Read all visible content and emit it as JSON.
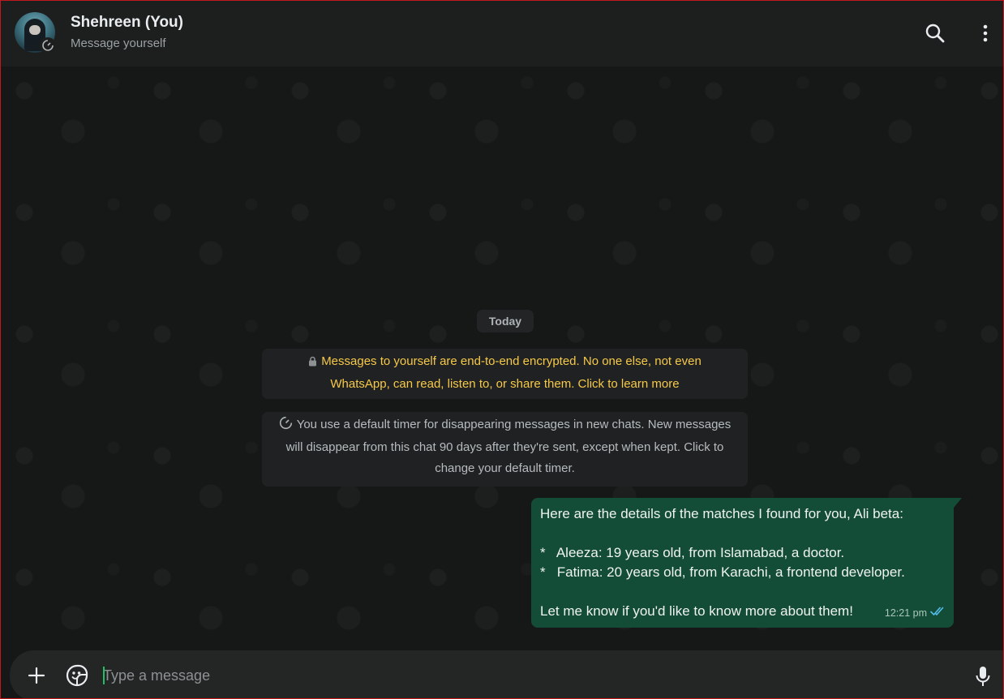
{
  "header": {
    "title": "Shehreen (You)",
    "subtitle": "Message yourself",
    "icons": [
      "avatar",
      "disappearing-timer-icon",
      "search-icon",
      "more-options-icon"
    ]
  },
  "chat": {
    "date_label": "Today",
    "encryption_notice": "Messages to yourself are end-to-end encrypted. No one else, not even WhatsApp, can read, listen to, or share them. Click to learn more",
    "timer_notice": "You use a default timer for disappearing messages in new chats. New messages will disappear from this chat 90 days after they're sent, except when kept. Click to change your default timer.",
    "message": {
      "line1": "Here are the details of the matches I found for you, Ali beta:",
      "line2": "*   Aleeza: 19 years old, from Islamabad, a doctor.",
      "line3": "*   Fatima: 20 years old, from Karachi, a frontend developer.",
      "line4": "Let me know if you'd like to know more about them!",
      "time": "12:21 pm",
      "status": "read"
    }
  },
  "composer": {
    "placeholder": "Type a message",
    "value": ""
  },
  "colors": {
    "header_bg": "#1d1f1f",
    "bubble_bg": "#144d37",
    "encryption_text": "#f7c948",
    "read_ticks": "#53bdeb",
    "caret": "#21c063"
  }
}
